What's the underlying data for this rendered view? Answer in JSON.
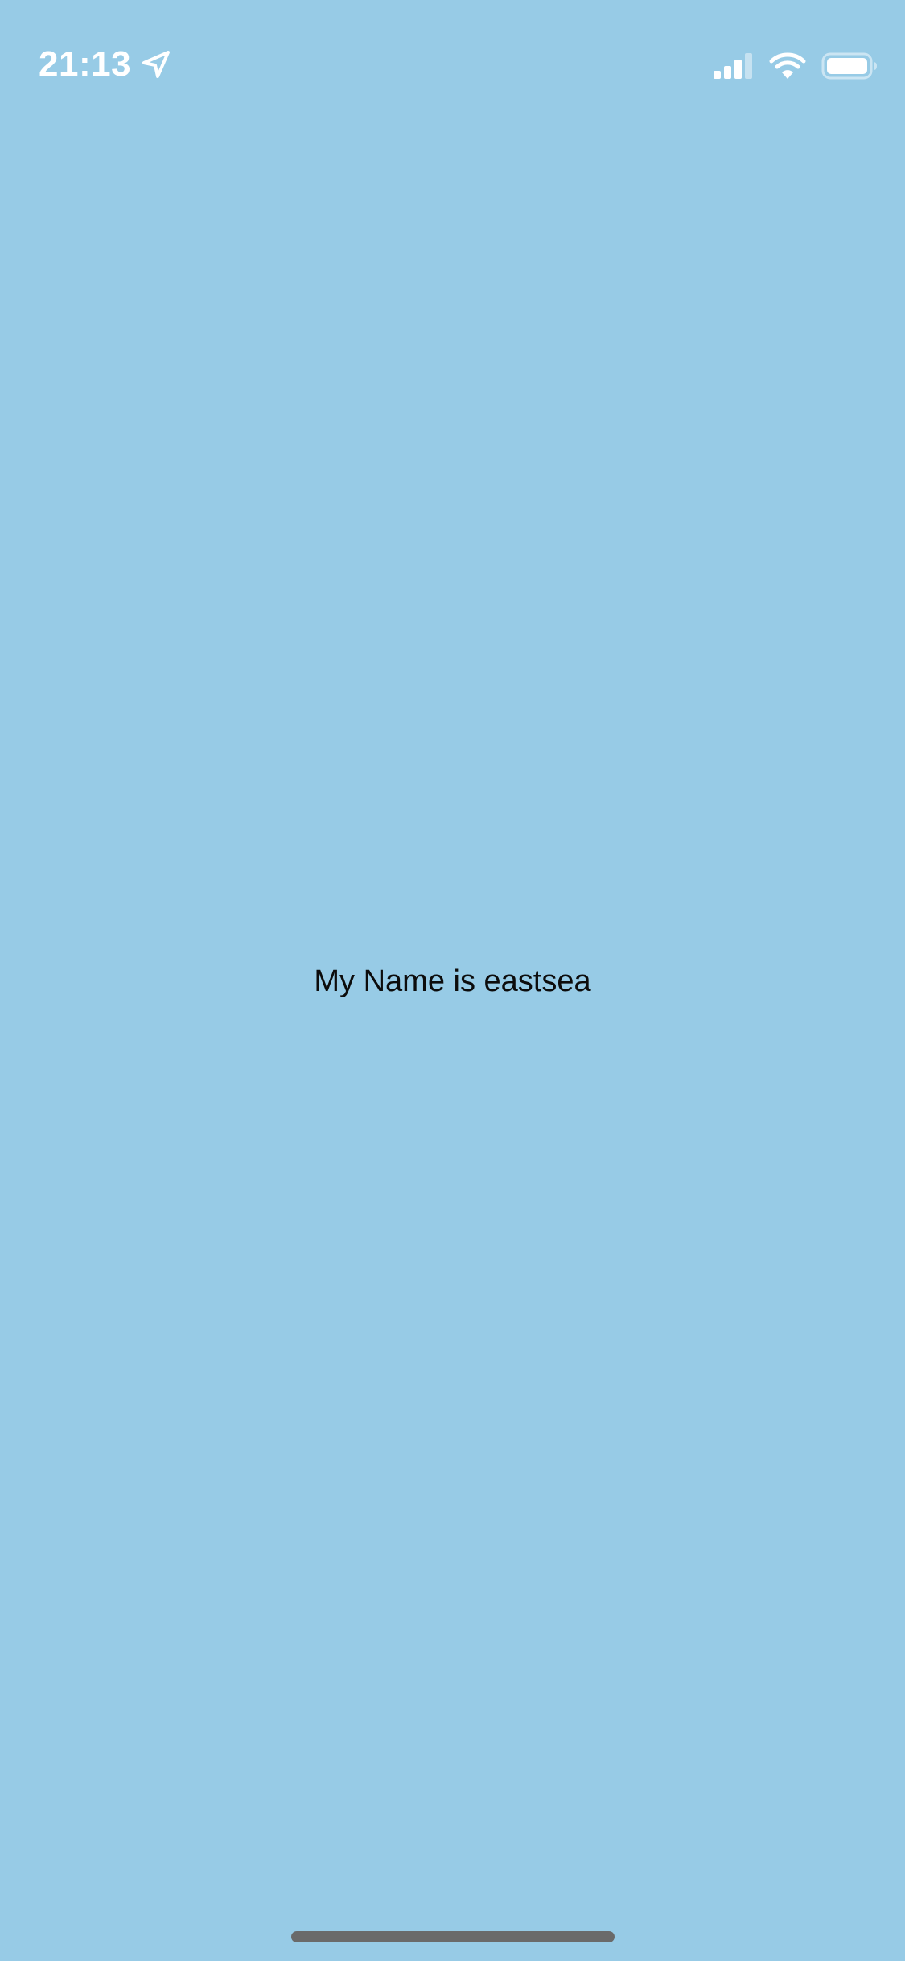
{
  "status_bar": {
    "time": "21:13",
    "icons": [
      "location-arrow-icon",
      "cellular-signal-icon",
      "wifi-icon",
      "battery-icon"
    ],
    "icon_color": "#FFFFFF"
  },
  "main": {
    "text": "My Name is eastsea"
  },
  "colors": {
    "background": "#97CBE6",
    "text": "#0C0C0C",
    "home_indicator": "#6A6A6A"
  }
}
